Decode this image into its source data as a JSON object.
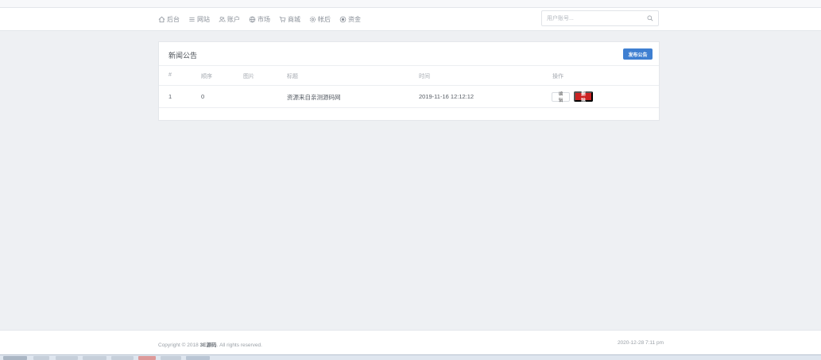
{
  "nav": {
    "items": [
      {
        "label": "后台",
        "icon": "home-icon"
      },
      {
        "label": "网站",
        "icon": "list-icon"
      },
      {
        "label": "账户",
        "icon": "users-icon"
      },
      {
        "label": "市场",
        "icon": "globe-icon"
      },
      {
        "label": "商城",
        "icon": "cart-icon"
      },
      {
        "label": "帐后",
        "icon": "gear-icon"
      },
      {
        "label": "资金",
        "icon": "coin-icon"
      }
    ]
  },
  "search": {
    "placeholder": "用户账号..."
  },
  "panel": {
    "title": "新闻公告",
    "publish_label": "发布公告",
    "columns": [
      "#",
      "顺序",
      "图片",
      "标题",
      "时间",
      "操作"
    ],
    "rows": [
      {
        "index": "1",
        "order": "0",
        "image": "",
        "title": "资源来自亲测源码网",
        "time": "2019-11-16 12:12:12",
        "edit_label": "编辑",
        "delete_label": "删除"
      }
    ]
  },
  "footer": {
    "copyright_prefix": "Copyright © 2018",
    "brand": "3E源码",
    "copyright_suffix": ". All rights reserved.",
    "datetime": "2020-12-28 7:11 pm"
  },
  "colors": {
    "accent": "#3f7fd1",
    "danger": "#cc2222",
    "background": "#eef0f3"
  }
}
